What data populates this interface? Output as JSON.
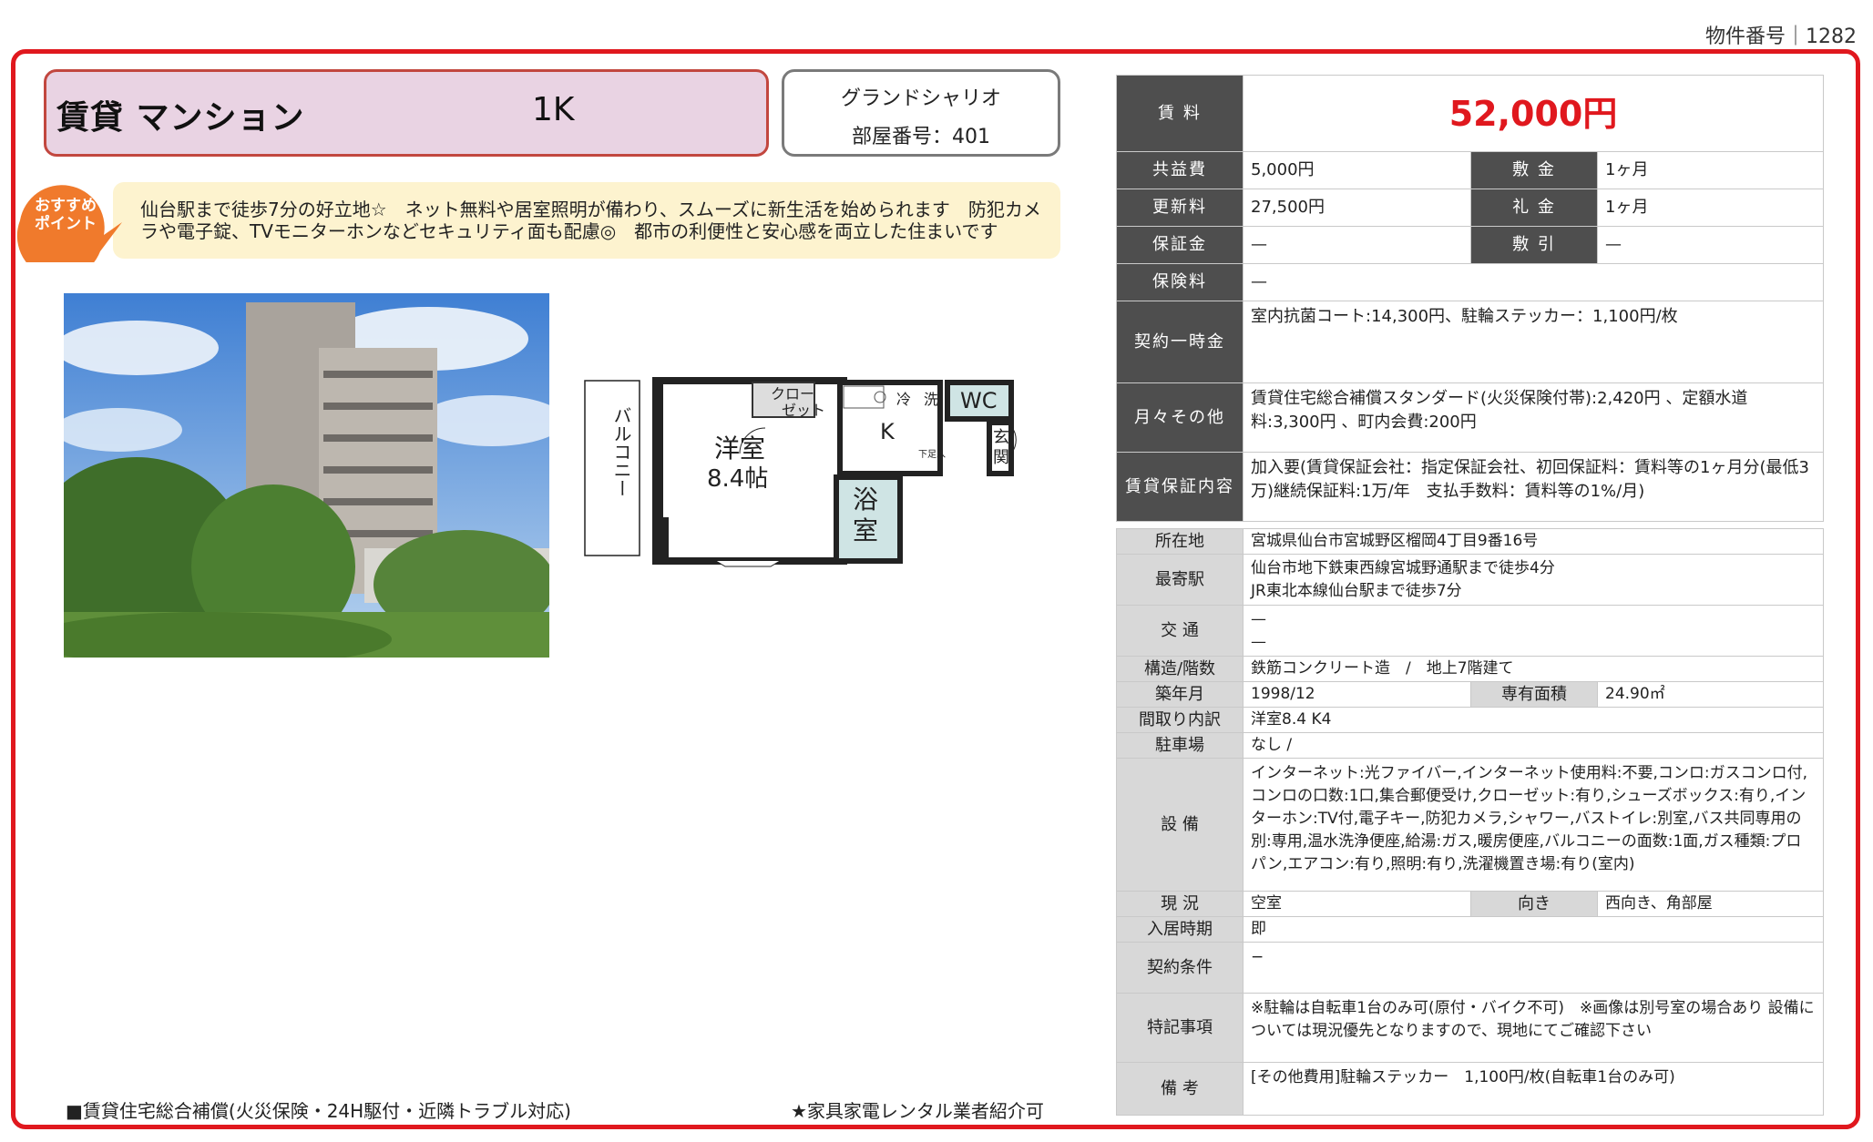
{
  "property_number": "物件番号｜1282",
  "header": {
    "type": "賃貸 マンション",
    "layout": "1K",
    "building_name": "グランドシャリオ",
    "room": "部屋番号：401"
  },
  "recommend": {
    "badge_line1": "おすすめ",
    "badge_line2": "ポイント",
    "text": "仙台駅まで徒歩7分の好立地☆　ネット無料や居室照明が備わり、スムーズに新生活を始められます　防犯カメラや電子錠、TVモニターホンなどセキュリティ面も配慮◎　都市の利便性と安心感を両立した住まいです"
  },
  "floorplan": {
    "balcony": "バルコニー",
    "closet1": "クロー",
    "closet2": "ゼット",
    "room_name": "洋室",
    "room_size": "8.4帖",
    "kitchen": "K",
    "fridge": "冷",
    "washer": "洗",
    "wc": "WC",
    "entrance1": "玄",
    "entrance2": "関",
    "bath1": "浴",
    "bath2": "室",
    "shoes": "下足入"
  },
  "footer": {
    "left": "■賃貸住宅総合補償(火災保険・24H駆付・近隣トラブル対応)",
    "right": "★家具家電レンタル業者紹介可"
  },
  "fees": {
    "rent_label": "賃 料",
    "rent": "52,000円",
    "common_label": "共益費",
    "common": "5,000円",
    "deposit_label": "敷 金",
    "deposit": "1ヶ月",
    "renewal_label": "更新料",
    "renewal": "27,500円",
    "key_money_label": "礼 金",
    "key_money": "1ヶ月",
    "guarantee_label": "保証金",
    "guarantee": "—",
    "deduction_label": "敷 引",
    "deduction": "—",
    "insurance_label": "保険料",
    "insurance": "—",
    "onetime_label": "契約一時金",
    "onetime": "室内抗菌コート:14,300円、駐輪ステッカー：1,100円/枚",
    "monthly_label": "月々その他",
    "monthly": "賃貸住宅総合補償スタンダード(火災保険付帯):2,420円 、定額水道料:3,300円 、町内会費:200円",
    "guarantor_label": "賃貸保証内容",
    "guarantor": "加入要(賃貸保証会社：指定保証会社、初回保証料：賃料等の1ヶ月分(最低3万)継続保証料:1万/年　支払手数料：賃料等の1%/月)"
  },
  "details": {
    "address_label": "所在地",
    "address": "宮城県仙台市宮城野区榴岡4丁目9番16号",
    "station_label": "最寄駅",
    "station1": "仙台市地下鉄東西線宮城野通駅まで徒歩4分",
    "station2": "JR東北本線仙台駅まで徒歩7分",
    "traffic_label": "交 通",
    "traffic1": "—",
    "traffic2": "—",
    "structure_label": "構造/階数",
    "structure": "鉄筋コンクリート造　/　地上7階建て",
    "built_label": "築年月",
    "built": "1998/12",
    "area_label": "専有面積",
    "area": "24.90㎡",
    "layout_label": "間取り内訳",
    "layout": "洋室8.4 K4",
    "parking_label": "駐車場",
    "parking": "なし /",
    "equipment_label": "設 備",
    "equipment": "インターネット:光ファイバー,インターネット使用料:不要,コンロ:ガスコンロ付,コンロの口数:1口,集合郵便受け,クローゼット:有り,シューズボックス:有り,インターホン:TV付,電子キー,防犯カメラ,シャワー,バストイレ:別室,バス共同専用の別:専用,温水洗浄便座,給湯:ガス,暖房便座,バルコニーの面数:1面,ガス種類:プロパン,エアコン:有り,照明:有り,洗濯機置き場:有り(室内)",
    "status_label": "現 況",
    "status": "空室",
    "direction_label": "向き",
    "direction": "西向き、角部屋",
    "movein_label": "入居時期",
    "movein": "即",
    "conditions_label": "契約条件",
    "conditions": "−",
    "notes_label": "特記事項",
    "notes": "※駐輪は自転車1台のみ可(原付・バイク不可)　※画像は別号室の場合あり 設備については現況優先となりますので、現地にてご確認下さい",
    "remarks_label": "備 考",
    "remarks": "[その他費用]駐輪ステッカー　1,100円/枚(自転車1台のみ可)"
  },
  "colors": {
    "frame": "#e0181e",
    "rent": "#e0181e",
    "type_box": "#e9d3e3",
    "recommend_bg": "#fdf3cf",
    "badge": "#f07a2c",
    "header_cell": "#4e4e4e"
  }
}
